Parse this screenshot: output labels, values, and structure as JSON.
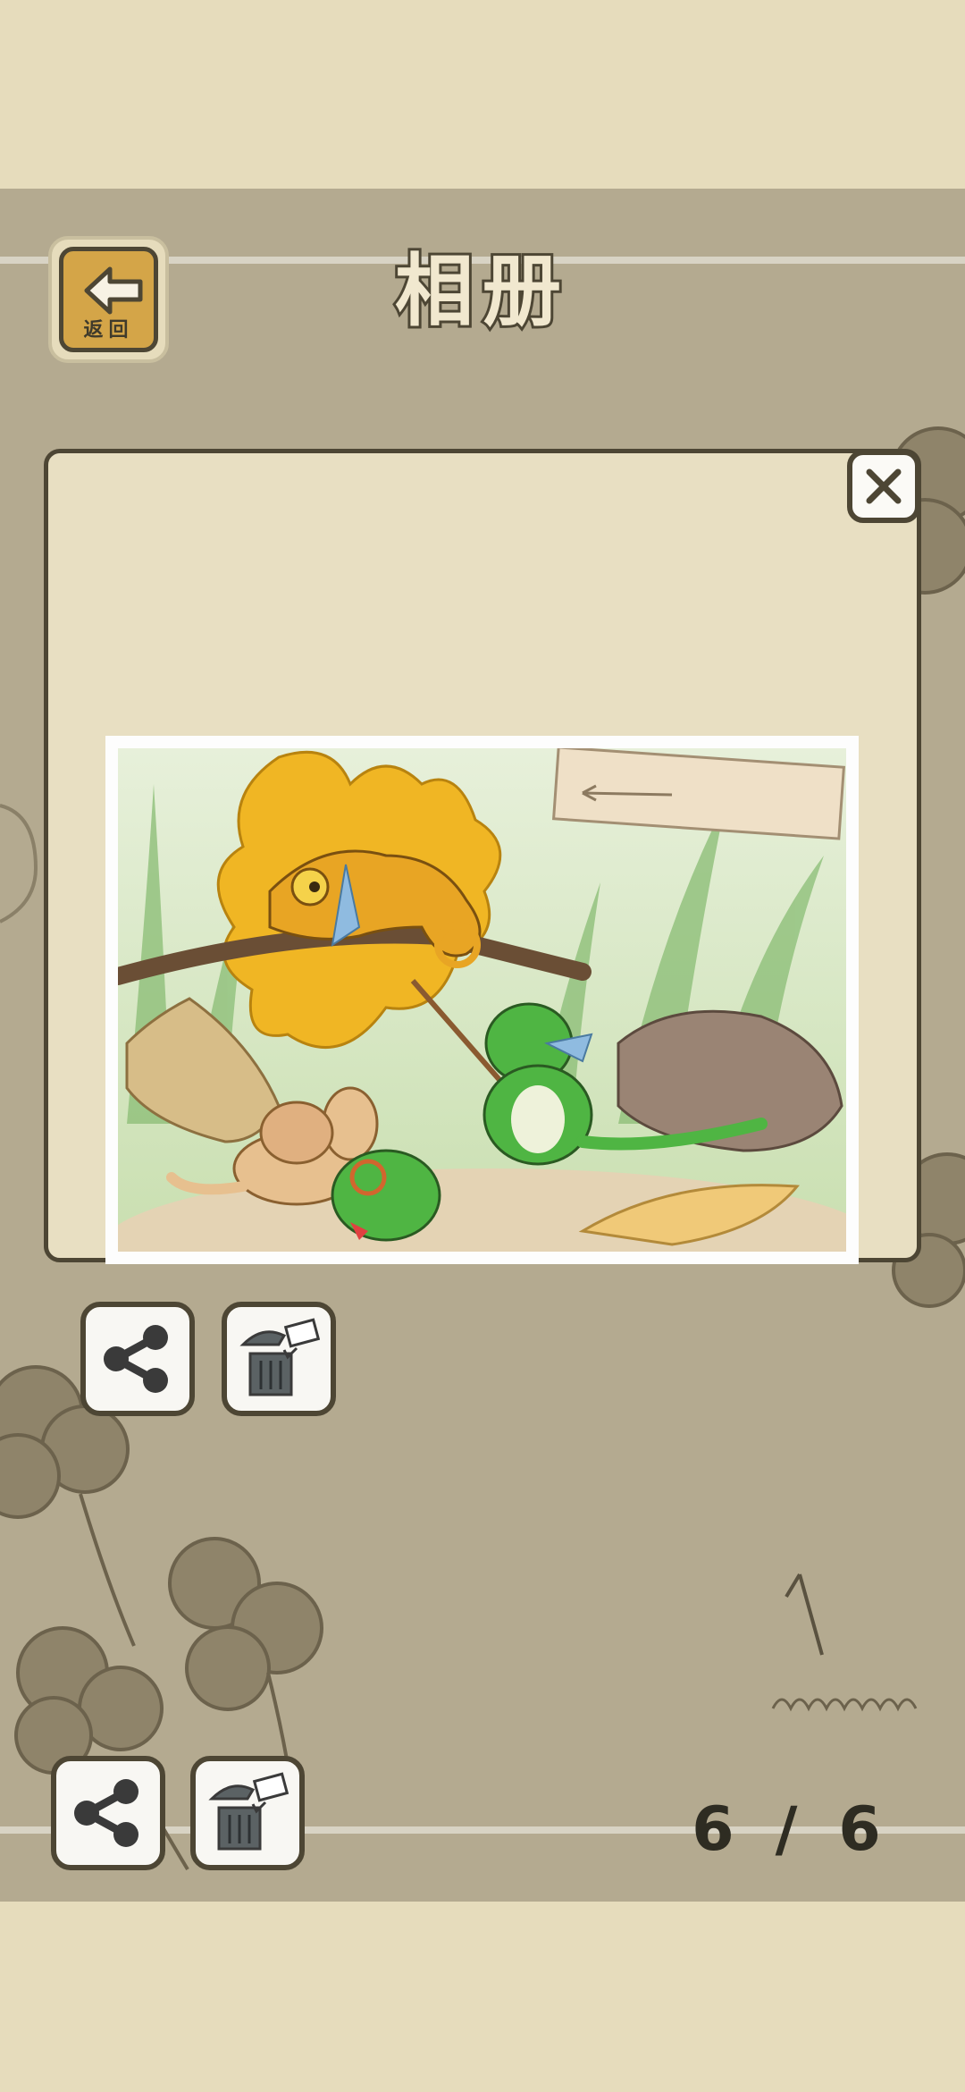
{
  "header": {
    "title": "相册",
    "back_label": "返回"
  },
  "counter": {
    "current": "6",
    "separator": "/",
    "total": "6"
  },
  "modal": {
    "actions": [
      {
        "name": "share",
        "icon": "share-icon"
      },
      {
        "name": "delete",
        "icon": "trash-icon"
      }
    ]
  },
  "icons": {
    "back": "arrow-left-icon",
    "close": "close-icon",
    "share": "share-icon",
    "delete": "trash-icon"
  },
  "colors": {
    "background": "#b4aa90",
    "panel": "#e8dfc2",
    "outline": "#4d4634",
    "back_button": "#d4a548",
    "thumb_selected_border": "#d9812f"
  }
}
